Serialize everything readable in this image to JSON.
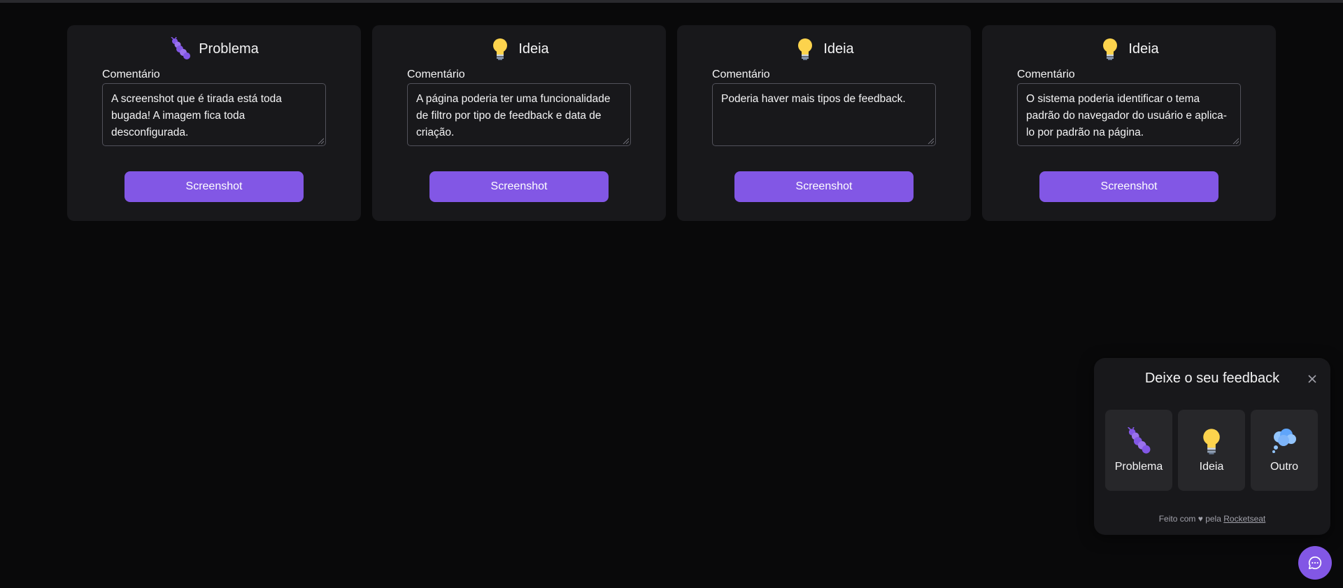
{
  "cards": [
    {
      "title": "Problema",
      "icon": "bug-icon",
      "comment_label": "Comentário",
      "comment": "A screenshot que é tirada está toda bugada! A imagem fica toda desconfigurada.",
      "button": "Screenshot"
    },
    {
      "title": "Ideia",
      "icon": "lightbulb-icon",
      "comment_label": "Comentário",
      "comment": "A página poderia ter uma funcionalidade de filtro por tipo de feedback e data de criação.",
      "button": "Screenshot"
    },
    {
      "title": "Ideia",
      "icon": "lightbulb-icon",
      "comment_label": "Comentário",
      "comment": "Poderia haver mais tipos de feedback.",
      "button": "Screenshot"
    },
    {
      "title": "Ideia",
      "icon": "lightbulb-icon",
      "comment_label": "Comentário",
      "comment": "O sistema poderia identificar o tema padrão do navegador do usuário e aplica-lo por padrão na página.",
      "button": "Screenshot"
    }
  ],
  "widget": {
    "title": "Deixe o seu feedback",
    "types": [
      {
        "label": "Problema",
        "icon": "bug-icon"
      },
      {
        "label": "Ideia",
        "icon": "lightbulb-icon"
      },
      {
        "label": "Outro",
        "icon": "thought-cloud-icon"
      }
    ],
    "footer_prefix": "Feito com ♥ pela",
    "footer_link": "Rocketseat"
  },
  "colors": {
    "background": "#09090a",
    "card": "#18181b",
    "brand": "#8257e5",
    "type_button": "#27272a"
  }
}
